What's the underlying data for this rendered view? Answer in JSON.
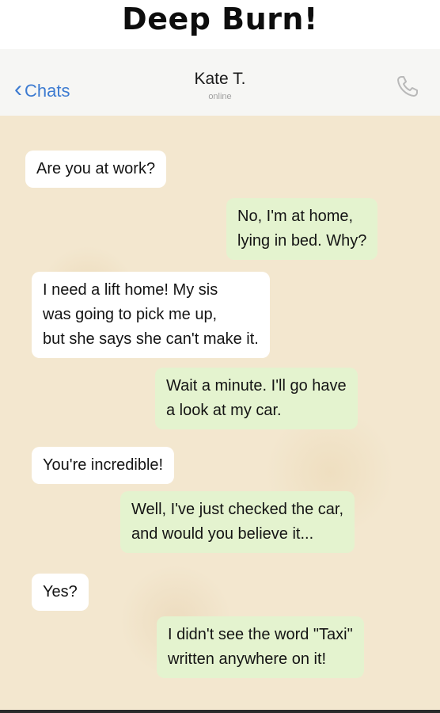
{
  "banner": {
    "title": "Deep Burn!"
  },
  "header": {
    "back_label": "Chats",
    "contact_name": "Kate T.",
    "status": "online",
    "call_icon": "phone-icon"
  },
  "messages": [
    {
      "direction": "incoming",
      "text": "Are you at work?"
    },
    {
      "direction": "outgoing",
      "text": "No, I'm at home,\nlying in bed. Why?"
    },
    {
      "direction": "incoming",
      "text": "I need a lift home! My sis\nwas going to pick me up,\nbut she says she can't make it."
    },
    {
      "direction": "outgoing",
      "text": "Wait a minute. I'll go have\na look at my car."
    },
    {
      "direction": "incoming",
      "text": "You're incredible!"
    },
    {
      "direction": "outgoing",
      "text": "Well, I've just checked the car,\nand would you believe it..."
    },
    {
      "direction": "incoming",
      "text": "Yes?"
    },
    {
      "direction": "outgoing",
      "text": "I didn't see the word \"Taxi\"\nwritten anywhere on it!"
    }
  ],
  "colors": {
    "incoming_bubble": "#ffffff",
    "outgoing_bubble": "#e4f3cf",
    "chat_background": "#f3e7cf",
    "link": "#3d7bd1"
  }
}
